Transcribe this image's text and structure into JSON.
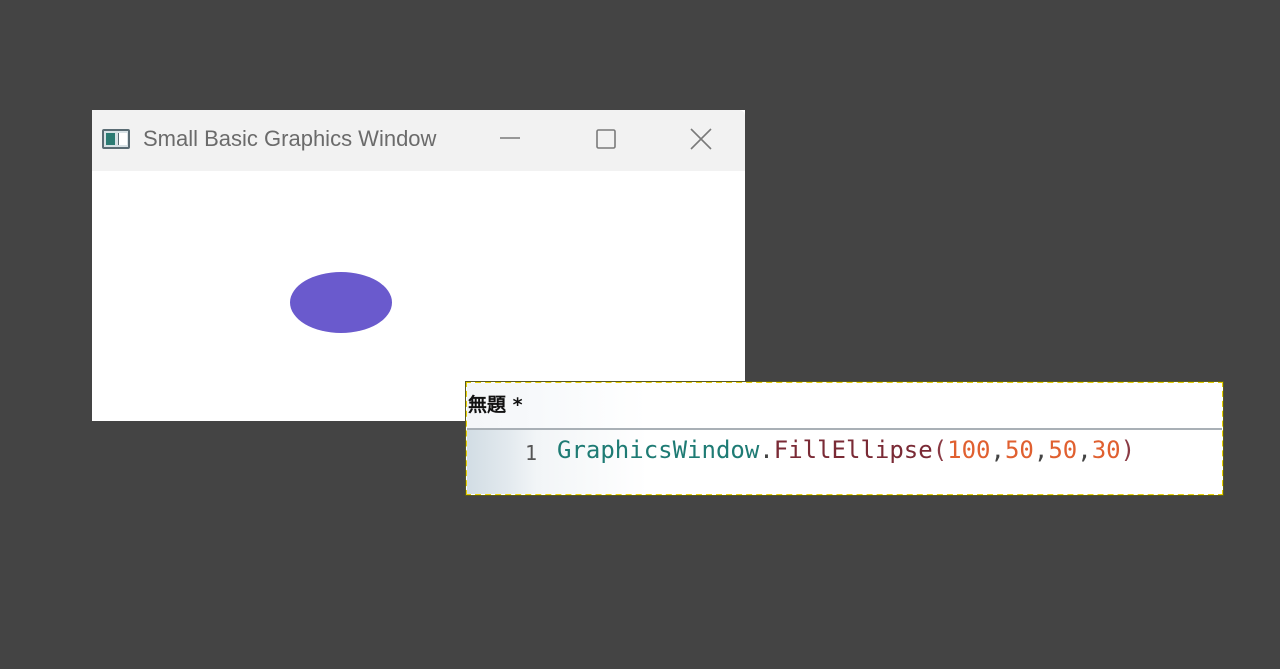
{
  "graphics_window": {
    "title": "Small Basic Graphics Window",
    "app_icon": "small-basic-window-icon",
    "controls": {
      "minimize_icon": "minimize-icon",
      "maximize_icon": "maximize-icon",
      "close_icon": "close-icon"
    },
    "ellipse_color": "#6a5acd"
  },
  "editor": {
    "tab_label": "無題 *",
    "lines": [
      {
        "number": "1",
        "object": "GraphicsWindow",
        "dot": ".",
        "method": "FillEllipse",
        "open_paren": "(",
        "args": [
          "100",
          "50",
          "50",
          "30"
        ],
        "comma": ",",
        "close_paren": ")"
      }
    ]
  },
  "colors": {
    "desktop_bg": "#444444",
    "selection_border": "#e8d000",
    "code_object": "#1e7b74",
    "code_method": "#7a2a35",
    "code_number": "#e06030"
  }
}
